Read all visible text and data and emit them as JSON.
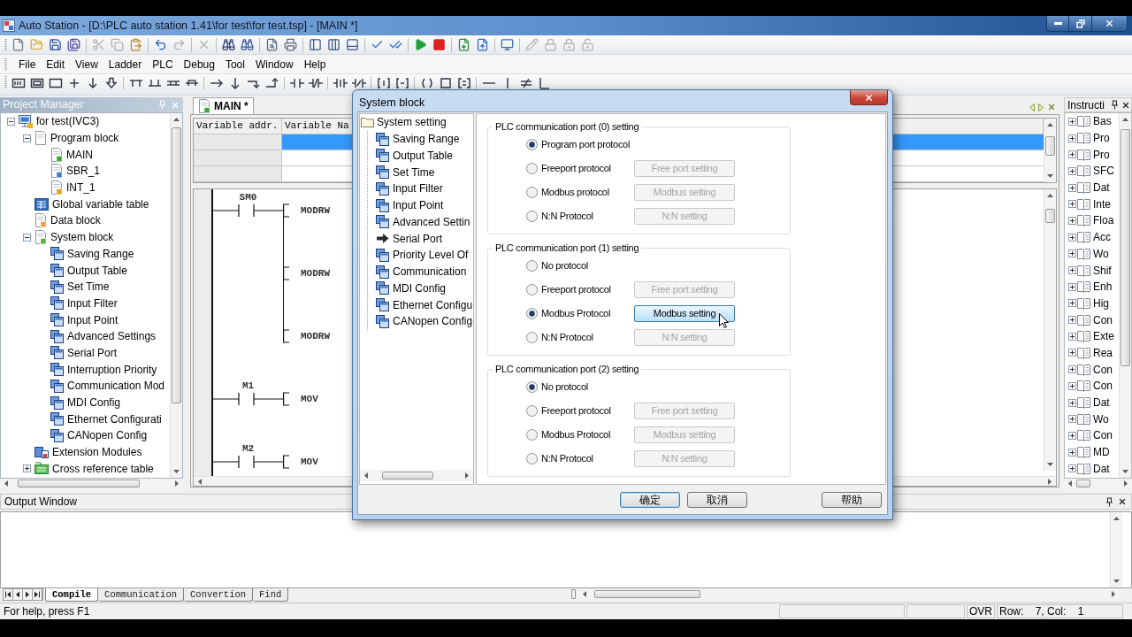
{
  "window": {
    "title": "Auto Station - [D:\\PLC auto station 1.41\\for test\\for test.tsp] - [MAIN *]"
  },
  "menu": [
    "File",
    "Edit",
    "View",
    "Ladder",
    "PLC",
    "Debug",
    "Tool",
    "Window",
    "Help"
  ],
  "project_manager": {
    "title": "Project Manager",
    "tree": [
      {
        "label": "for test(IVC3)",
        "kind": "project",
        "expanded": true,
        "children": [
          {
            "label": "Program block",
            "kind": "program",
            "expanded": true,
            "children": [
              {
                "label": "MAIN",
                "kind": "main"
              },
              {
                "label": "SBR_1",
                "kind": "subroutine"
              },
              {
                "label": "INT_1",
                "kind": "interrupt"
              }
            ]
          },
          {
            "label": "Global variable table",
            "kind": "variables"
          },
          {
            "label": "Data block",
            "kind": "data"
          },
          {
            "label": "System block",
            "kind": "system",
            "expanded": true,
            "children": [
              {
                "label": "Saving Range",
                "kind": "setting"
              },
              {
                "label": "Output Table",
                "kind": "setting"
              },
              {
                "label": "Set Time",
                "kind": "setting"
              },
              {
                "label": "Input Filter",
                "kind": "setting"
              },
              {
                "label": "Input Point",
                "kind": "setting"
              },
              {
                "label": "Advanced Settings",
                "kind": "setting"
              },
              {
                "label": "Serial Port",
                "kind": "setting"
              },
              {
                "label": "Interruption Priority",
                "kind": "setting"
              },
              {
                "label": "Communication Mod",
                "kind": "setting"
              },
              {
                "label": "MDI Config",
                "kind": "setting"
              },
              {
                "label": "Ethernet Configurati",
                "kind": "setting"
              },
              {
                "label": "CANopen Config",
                "kind": "setting"
              }
            ]
          },
          {
            "label": "Extension Modules",
            "kind": "modules"
          },
          {
            "label": "Cross reference table",
            "kind": "crossref",
            "expanded": false
          }
        ]
      }
    ]
  },
  "editor": {
    "tab": {
      "label": "MAIN *",
      "selected": true
    },
    "variable_table": {
      "columns": [
        "Variable addr.",
        "Variable Na"
      ],
      "rows": [
        {
          "selected": true
        },
        {
          "selected": false
        },
        {
          "selected": false
        }
      ]
    },
    "ladder": {
      "rungs": [
        {
          "contact": "SM0",
          "outputs": [
            "MODRW",
            "MODRW",
            "MODRW"
          ]
        },
        {
          "contact": "M1",
          "outputs": [
            "MOV"
          ]
        },
        {
          "contact": "M2",
          "outputs": [
            "MOV"
          ]
        }
      ]
    }
  },
  "instructions": {
    "title": "Instructi",
    "tree": [
      {
        "label": "Bas",
        "expanded": false
      },
      {
        "label": "Pro",
        "expanded": false
      },
      {
        "label": "Pro",
        "expanded": false
      },
      {
        "label": "SFC",
        "expanded": false
      },
      {
        "label": "Dat",
        "expanded": false
      },
      {
        "label": "Inte",
        "expanded": false
      },
      {
        "label": "Floa",
        "expanded": false
      },
      {
        "label": "Acc",
        "expanded": false
      },
      {
        "label": "Wo",
        "expanded": false
      },
      {
        "label": "Shif",
        "expanded": false
      },
      {
        "label": "Enh",
        "expanded": false
      },
      {
        "label": "Hig",
        "expanded": false
      },
      {
        "label": "Con",
        "expanded": false
      },
      {
        "label": "Exte",
        "expanded": false
      },
      {
        "label": "Rea",
        "expanded": false
      },
      {
        "label": "Con",
        "expanded": false
      },
      {
        "label": "Con",
        "expanded": false
      },
      {
        "label": "Dat",
        "expanded": false
      },
      {
        "label": "Wo",
        "expanded": false
      },
      {
        "label": "Con",
        "expanded": false
      },
      {
        "label": "MD",
        "expanded": false
      },
      {
        "label": "Dat",
        "expanded": false
      }
    ]
  },
  "output_window": {
    "title": "Output Window",
    "tabs": [
      {
        "label": "Compile",
        "selected": true
      },
      {
        "label": "Communication",
        "selected": false
      },
      {
        "label": "Convertion",
        "selected": false
      },
      {
        "label": "Find",
        "selected": false
      }
    ]
  },
  "status_bar": {
    "help": "For help, press F1",
    "mode": "OVR",
    "position": "Row:    7, Col:    1"
  },
  "dialog": {
    "title": "System block",
    "tree": {
      "label": "System setting",
      "children": [
        {
          "label": "Saving Range",
          "selected": false
        },
        {
          "label": "Output Table",
          "selected": false
        },
        {
          "label": "Set Time",
          "selected": false
        },
        {
          "label": "Input Filter",
          "selected": false
        },
        {
          "label": "Input Point",
          "selected": false
        },
        {
          "label": "Advanced Settin",
          "selected": false
        },
        {
          "label": "Serial Port",
          "selected": true
        },
        {
          "label": "Priority Level Of",
          "selected": false
        },
        {
          "label": "Communication",
          "selected": false
        },
        {
          "label": "MDI Config",
          "selected": false
        },
        {
          "label": "Ethernet Configu",
          "selected": false
        },
        {
          "label": "CANopen Config",
          "selected": false
        }
      ]
    },
    "groups": [
      {
        "title": "PLC communication port (0) setting",
        "options": [
          {
            "label": "Program port protocol",
            "selected": true
          },
          {
            "label": "Freeport protocol",
            "selected": false,
            "button": {
              "label": "Free port setting",
              "disabled": true,
              "hovered": false
            }
          },
          {
            "label": "Modbus protocol",
            "selected": false,
            "button": {
              "label": "Modbus setting",
              "disabled": true,
              "hovered": false
            }
          },
          {
            "label": "N:N Protocol",
            "selected": false,
            "button": {
              "label": "N:N setting",
              "disabled": true,
              "hovered": false
            }
          }
        ]
      },
      {
        "title": "PLC communication port (1) setting",
        "options": [
          {
            "label": "No protocol",
            "selected": false
          },
          {
            "label": "Freeport protocol",
            "selected": false,
            "button": {
              "label": "Free port setting",
              "disabled": true,
              "hovered": false
            }
          },
          {
            "label": "Modbus Protocol",
            "selected": true,
            "button": {
              "label": "Modbus setting",
              "disabled": false,
              "hovered": true
            }
          },
          {
            "label": "N:N Protocol",
            "selected": false,
            "button": {
              "label": "N:N setting",
              "disabled": true,
              "hovered": false
            }
          }
        ]
      },
      {
        "title": "PLC communication port (2) setting",
        "options": [
          {
            "label": "No protocol",
            "selected": true
          },
          {
            "label": "Freeport protocol",
            "selected": false,
            "button": {
              "label": "Free port setting",
              "disabled": true,
              "hovered": false
            }
          },
          {
            "label": "Modbus Protocol",
            "selected": false,
            "button": {
              "label": "Modbus setting",
              "disabled": true,
              "hovered": false
            }
          },
          {
            "label": "N:N Protocol",
            "selected": false,
            "button": {
              "label": "N:N setting",
              "disabled": true,
              "hovered": false
            }
          }
        ]
      }
    ],
    "buttons": [
      {
        "label": "确定",
        "default": true
      },
      {
        "label": "取消",
        "default": false
      },
      {
        "label": "帮助",
        "default": false
      }
    ]
  }
}
